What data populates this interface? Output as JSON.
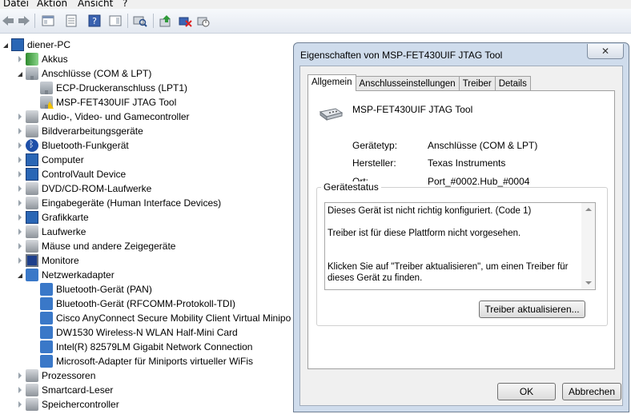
{
  "menu": [
    "Datei",
    "Aktion",
    "Ansicht",
    "?"
  ],
  "toolbar": {
    "icons": [
      "back-icon",
      "forward-icon",
      "properties-pane-icon",
      "list-icon",
      "show-hide-icon",
      "help-icon",
      "toolbar-pane-icon",
      "scan-hardware-icon",
      "update-driver-icon",
      "uninstall-icon",
      "disable-icon"
    ]
  },
  "tree": {
    "root": "diener-PC",
    "items": [
      {
        "label": "Akkus",
        "level": 1,
        "state": "collapsed",
        "icon": "battery-icon"
      },
      {
        "label": "Anschlüsse (COM & LPT)",
        "level": 1,
        "state": "expanded",
        "icon": "port-icon"
      },
      {
        "label": "ECP-Druckeranschluss (LPT1)",
        "level": 2,
        "state": "none",
        "icon": "port-icon"
      },
      {
        "label": "MSP-FET430UIF JTAG Tool",
        "level": 2,
        "state": "none",
        "icon": "port-warning-icon"
      },
      {
        "label": "Audio-, Video- und Gamecontroller",
        "level": 1,
        "state": "collapsed",
        "icon": "speaker-icon"
      },
      {
        "label": "Bildverarbeitungsgeräte",
        "level": 1,
        "state": "collapsed",
        "icon": "camera-icon"
      },
      {
        "label": "Bluetooth-Funkgerät",
        "level": 1,
        "state": "collapsed",
        "icon": "bluetooth-icon"
      },
      {
        "label": "Computer",
        "level": 1,
        "state": "collapsed",
        "icon": "computer-icon"
      },
      {
        "label": "ControlVault Device",
        "level": 1,
        "state": "collapsed",
        "icon": "computer-icon"
      },
      {
        "label": "DVD/CD-ROM-Laufwerke",
        "level": 1,
        "state": "collapsed",
        "icon": "disc-drive-icon"
      },
      {
        "label": "Eingabegeräte (Human Interface Devices)",
        "level": 1,
        "state": "collapsed",
        "icon": "hid-icon"
      },
      {
        "label": "Grafikkarte",
        "level": 1,
        "state": "collapsed",
        "icon": "display-adapter-icon"
      },
      {
        "label": "Laufwerke",
        "level": 1,
        "state": "collapsed",
        "icon": "drive-icon"
      },
      {
        "label": "Mäuse und andere Zeigegeräte",
        "level": 1,
        "state": "collapsed",
        "icon": "mouse-icon"
      },
      {
        "label": "Monitore",
        "level": 1,
        "state": "collapsed",
        "icon": "monitor-icon"
      },
      {
        "label": "Netzwerkadapter",
        "level": 1,
        "state": "expanded",
        "icon": "network-icon"
      },
      {
        "label": "Bluetooth-Gerät (PAN)",
        "level": 2,
        "state": "none",
        "icon": "network-icon"
      },
      {
        "label": "Bluetooth-Gerät (RFCOMM-Protokoll-TDI)",
        "level": 2,
        "state": "none",
        "icon": "network-icon"
      },
      {
        "label": "Cisco AnyConnect Secure Mobility Client Virtual Minipo",
        "level": 2,
        "state": "none",
        "icon": "network-icon"
      },
      {
        "label": "DW1530 Wireless-N WLAN Half-Mini Card",
        "level": 2,
        "state": "none",
        "icon": "network-icon"
      },
      {
        "label": "Intel(R) 82579LM Gigabit Network Connection",
        "level": 2,
        "state": "none",
        "icon": "network-icon"
      },
      {
        "label": "Microsoft-Adapter für Miniports virtueller WiFis",
        "level": 2,
        "state": "none",
        "icon": "network-icon"
      },
      {
        "label": "Prozessoren",
        "level": 1,
        "state": "collapsed",
        "icon": "processor-icon"
      },
      {
        "label": "Smartcard-Leser",
        "level": 1,
        "state": "collapsed",
        "icon": "smartcard-icon"
      },
      {
        "label": "Speichercontroller",
        "level": 1,
        "state": "collapsed",
        "icon": "storage-controller-icon"
      }
    ]
  },
  "dialog": {
    "title": "Eigenschaften von MSP-FET430UIF JTAG Tool",
    "close_label": "✕",
    "tabs": [
      "Allgemein",
      "Anschlusseinstellungen",
      "Treiber",
      "Details"
    ],
    "active_tab": "Allgemein",
    "device_name": "MSP-FET430UIF JTAG Tool",
    "properties": [
      {
        "key": "Gerätetyp:",
        "value": "Anschlüsse (COM & LPT)"
      },
      {
        "key": "Hersteller:",
        "value": "Texas Instruments"
      },
      {
        "key": "Ort:",
        "value": "Port_#0002.Hub_#0004"
      }
    ],
    "status_label": "Gerätestatus",
    "status_text": "Dieses Gerät ist nicht richtig konfiguriert. (Code 1)\n\nTreiber ist für diese Plattform nicht vorgesehen.\n\n\nKlicken Sie auf \"Treiber aktualisieren\", um einen Treiber für dieses Gerät zu finden.",
    "update_driver_button": "Treiber aktualisieren...",
    "ok_button": "OK",
    "cancel_button": "Abbrechen"
  }
}
